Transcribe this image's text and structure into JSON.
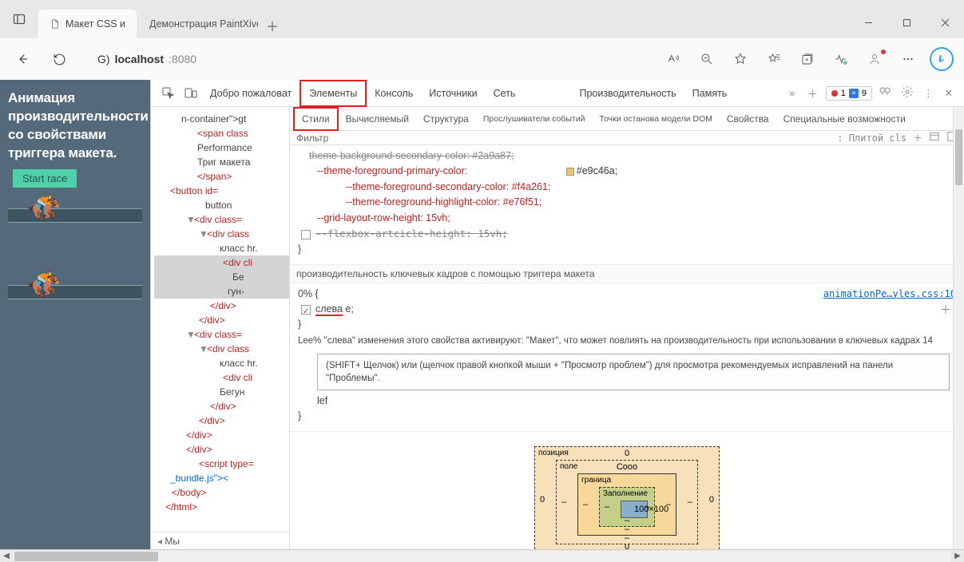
{
  "tabs": [
    {
      "label": "Макет CSS и"
    },
    {
      "label": "Демонстрация PaintXive"
    }
  ],
  "url": {
    "prefix": "G)",
    "host": "localhost",
    "port": ":8080"
  },
  "page": {
    "title": "Анимация производительности со свойствами триггера макета.",
    "start_button": "Start race"
  },
  "devtools": {
    "welcome": "Добро пожаловат",
    "tabs": [
      "Элементы",
      "Консоль",
      "Источники",
      "Сеть",
      "Производительность",
      "Память"
    ],
    "active_tab": "Элементы",
    "errors": "1",
    "messages": "9",
    "sub_tabs": [
      "Стили",
      "Вычисляемый",
      "Структура",
      "Прослушиватели событий",
      "Точки останова модели DOM",
      "Свойства",
      "Специальные возможности"
    ],
    "active_sub_tab": "Стили",
    "filter_label": "Фильтр",
    "filter_right": ": Плитой cls",
    "crumb": "Мы"
  },
  "dom": {
    "l1": "n-container\">gt",
    "l2": "<span class",
    "l3": "Performance",
    "l4": "Триг макета",
    "l5": "</span>",
    "l6": "<button id=",
    "l7": "button",
    "l8": "<div class=",
    "l9": "<div class",
    "l10": "класс hr.",
    "l11": "<div cli",
    "l12": "Бе",
    "l13": "гун-",
    "l14": "</div>",
    "l15": "</div>",
    "l16": "<div class=",
    "l17": "<div class",
    "l18": "класс hr.",
    "l19": "<div cli",
    "l20": "Бегун",
    "l21": "</div>",
    "l22": "</div>",
    "l23": "</div>",
    "l24": "</div>",
    "l25": "<script type=",
    "l26": "_bundle.js\"><",
    "l27": "</body>",
    "l28": "</html>"
  },
  "css": {
    "prop0": "theme-background-secondary-color: #2a9a87;",
    "prop1_n": "--theme-foreground-primary-color:",
    "prop1_v": "#e9c46a;",
    "prop2": "--theme-foreground-secondary-color: #f4a261;",
    "prop3": "--theme-foreground-highlight-color: #e76f51;",
    "prop4": "--grid-layout-row-height: 15vh;",
    "prop5": "--flexbox-artcicle-height: 15vh;",
    "section_title": "производительность ключевых кадров с помощью триггера макета",
    "kf_sel": "0% {",
    "kf_prop": "слева",
    "kf_val": " e;",
    "src_link": "animationPe…yles.css:10",
    "tooltip_pre": "Lee% \"слева\" изменения этого свойства активируют: \"Макет\", что может повлиять на производительность при использовании в ключевых кадрах 14",
    "tooltip_body": "(SHIFT+ Щелчок) или (щелчок правой кнопкой мыши + \"Просмотр проблем\") для просмотра рекомендуемых исправлений на панели \"Проблемы\".",
    "lef": "lef"
  },
  "boxmodel": {
    "position": "позиция",
    "margin": "поле",
    "margin_t": "Cooo",
    "border": "граница",
    "padding": "Заполнение",
    "content": "100×100",
    "dash": "–",
    "zero": "0"
  }
}
